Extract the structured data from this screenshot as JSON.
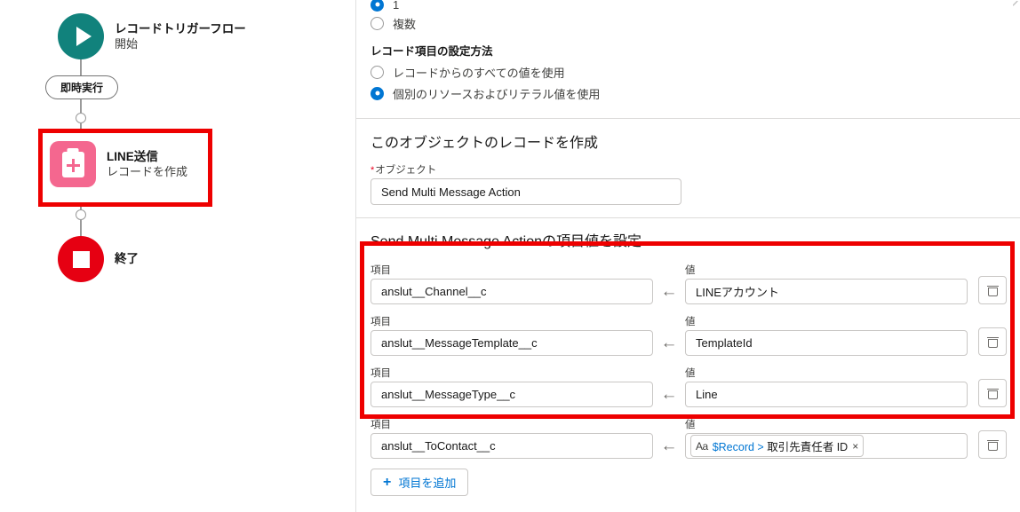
{
  "colors": {
    "accent_blue": "#0176d3",
    "annotation_red": "#ee0000",
    "start_node_teal": "#11827c",
    "end_node_red": "#e60012",
    "element_icon_pink": "#f4678f",
    "required_star": "#ea001e",
    "border_gray": "#c9c7c5"
  },
  "flow_canvas": {
    "start_node": {
      "title": "レコードトリガーフロー",
      "subtitle": "開始",
      "icon": "play-icon"
    },
    "path_pill": {
      "label": "即時実行"
    },
    "element_node": {
      "title": "LINE送信",
      "subtitle": "レコードを作成",
      "icon": "create-record-icon",
      "highlighted": true
    },
    "end_node": {
      "title": "終了",
      "icon": "stop-icon"
    }
  },
  "panel": {
    "record_count_group": {
      "options": [
        {
          "label": "1",
          "checked": true
        },
        {
          "label": "複数",
          "checked": false
        }
      ]
    },
    "field_method_group": {
      "heading": "レコード項目の設定方法",
      "options": [
        {
          "label": "レコードからのすべての値を使用",
          "checked": false
        },
        {
          "label": "個別のリソースおよびリテラル値を使用",
          "checked": true
        }
      ]
    },
    "object_section": {
      "title": "このオブジェクトのレコードを作成",
      "field_label": "オブジェクト",
      "required_marker": "*",
      "value": "Send Multi Message Action"
    },
    "field_values_section": {
      "title": "Send Multi Message Actionの項目値を設定",
      "field_column_label": "項目",
      "value_column_label": "値",
      "arrow_glyph": "←",
      "rows": [
        {
          "field": "anslut__Channel__c",
          "value": "LINEアカウント",
          "value_type": "text",
          "delete_icon": "trash-icon"
        },
        {
          "field": "anslut__MessageTemplate__c",
          "value": "TemplateId",
          "value_type": "text",
          "delete_icon": "trash-icon"
        },
        {
          "field": "anslut__MessageType__c",
          "value": "Line",
          "value_type": "text",
          "delete_icon": "trash-icon"
        },
        {
          "field": "anslut__ToContact__c",
          "value_type": "token",
          "token": {
            "type_icon": "Aa",
            "resource": "$Record",
            "separator": ">",
            "field_name": "取引先責任者 ID",
            "remove_icon": "×"
          },
          "delete_icon": "trash-icon"
        }
      ],
      "add_button": {
        "label": "項目を追加",
        "icon": "plus-icon"
      }
    }
  }
}
